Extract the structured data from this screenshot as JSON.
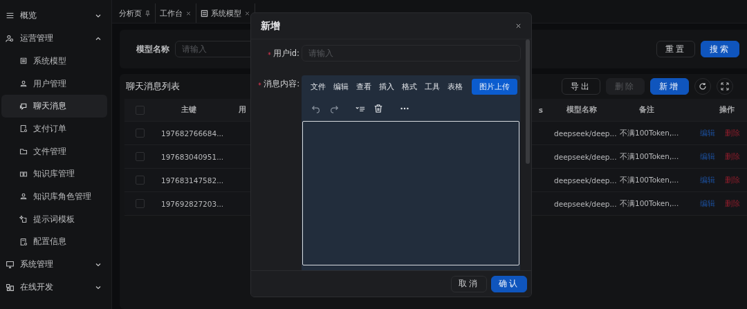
{
  "sidebar": {
    "items": [
      {
        "label": "概览",
        "expanded": false
      },
      {
        "label": "运营管理",
        "expanded": true,
        "children": [
          {
            "label": "系统模型",
            "selected": false
          },
          {
            "label": "用户管理",
            "selected": false
          },
          {
            "label": "聊天消息",
            "selected": true
          },
          {
            "label": "支付订单",
            "selected": false
          },
          {
            "label": "文件管理",
            "selected": false
          },
          {
            "label": "知识库管理",
            "selected": false
          },
          {
            "label": "知识库角色管理",
            "selected": false
          },
          {
            "label": "提示词模板",
            "selected": false
          },
          {
            "label": "配置信息",
            "selected": false
          }
        ]
      },
      {
        "label": "系统管理",
        "expanded": false
      },
      {
        "label": "在线开发",
        "expanded": false
      }
    ]
  },
  "tabs": [
    {
      "label": "分析页",
      "kind": "pinned",
      "selected": false
    },
    {
      "label": "工作台",
      "kind": "closable",
      "selected": false
    },
    {
      "label": "系统模型",
      "kind": "closable",
      "selected": false
    }
  ],
  "search": {
    "label": "模型名称",
    "placeholder": "请输入",
    "buttons": [
      {
        "label": "重置",
        "kind": "default"
      },
      {
        "label": "搜索",
        "kind": "primary"
      }
    ]
  },
  "table": {
    "title": "聊天消息列表",
    "toolbar": [
      {
        "label": "导出",
        "kind": "default",
        "disabled": false
      },
      {
        "label": "删除",
        "kind": "default",
        "disabled": true
      },
      {
        "label": "新增",
        "kind": "primary",
        "disabled": false
      }
    ],
    "header_checked": false,
    "columns": [
      "主键",
      "用",
      "s",
      "模型名称",
      "备注",
      "操作"
    ],
    "rows": [
      {
        "checked": false,
        "id": "197682766684...",
        "model": "deepseek/deep...",
        "note": "不满100Token,...",
        "actions": [
          "编辑",
          "删除"
        ]
      },
      {
        "checked": false,
        "id": "197683040951...",
        "model": "deepseek/deep...",
        "note": "不满100Token,...",
        "actions": [
          "编辑",
          "删除"
        ]
      },
      {
        "checked": false,
        "id": "197683147582...",
        "model": "deepseek/deep...",
        "note": "不满100Token,...",
        "actions": [
          "编辑",
          "删除"
        ]
      },
      {
        "checked": false,
        "id": "197692827203...",
        "model": "deepseek/deep...",
        "note": "不满100Token,...",
        "actions": [
          "编辑",
          "删除"
        ]
      }
    ]
  },
  "dialog": {
    "title": "新增",
    "user_field": {
      "label": "用户id:",
      "required": true,
      "placeholder": "请输入"
    },
    "content_field": {
      "label": "消息内容:",
      "required": true
    },
    "editor": {
      "menu": [
        "文件",
        "编辑",
        "查看",
        "插入",
        "格式",
        "工具",
        "表格"
      ],
      "upload_button": "图片上传"
    },
    "buttons": [
      {
        "label": "取消",
        "kind": "default"
      },
      {
        "label": "确认",
        "kind": "primary"
      }
    ]
  }
}
